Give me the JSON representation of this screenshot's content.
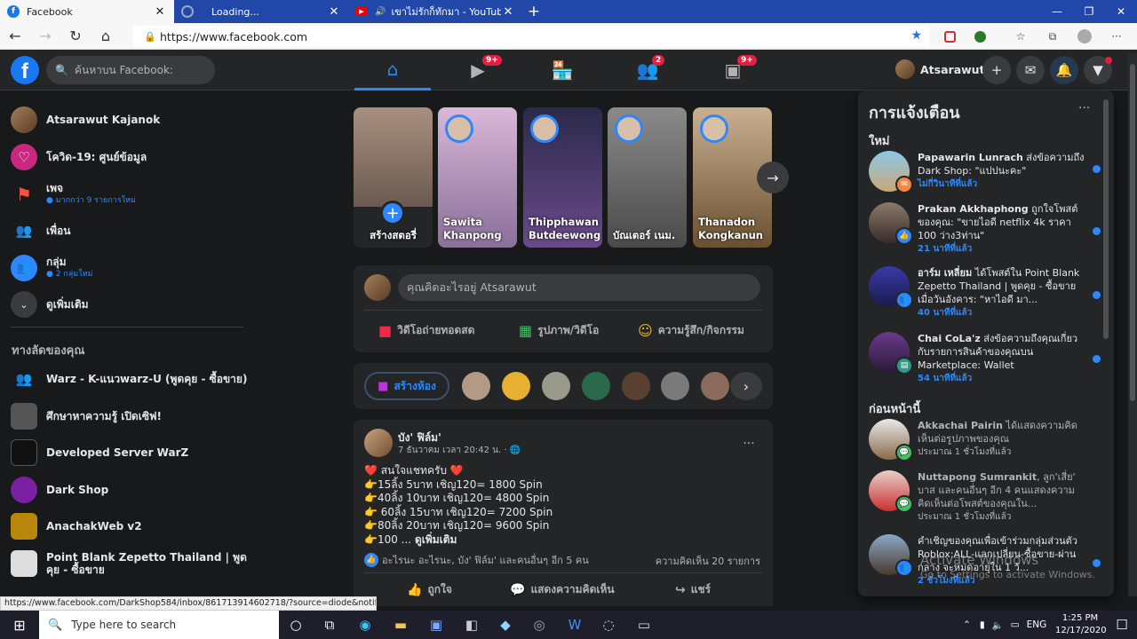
{
  "browser": {
    "tabs": [
      {
        "label": "Facebook",
        "active": true
      },
      {
        "label": "Loading...",
        "active": false
      },
      {
        "label": "เขาไม่รักก็ทักมา - YouTube",
        "active": false
      }
    ],
    "tab_close": "✕",
    "new_tab": "+",
    "url": "https://www.facebook.com",
    "window_controls": {
      "minimize": "—",
      "restore": "❐",
      "close": "✕"
    }
  },
  "header": {
    "search_placeholder": "ค้นหาบน Facebook:",
    "nav_badges": {
      "watch": "9+",
      "groups": "2",
      "gaming": "9+"
    },
    "profile_name": "Atsarawut"
  },
  "sidebar": {
    "items": [
      {
        "label": "Atsarawut Kajanok",
        "sub": ""
      },
      {
        "label": "โควิด-19: ศูนย์ข้อมูล",
        "sub": ""
      },
      {
        "label": "เพจ",
        "sub": "● มากกว่า 9 รายการใหม่"
      },
      {
        "label": "เพื่อน",
        "sub": ""
      },
      {
        "label": "กลุ่ม",
        "sub": "● 2 กลุ่มใหม่"
      },
      {
        "label": "ดูเพิ่มเติม",
        "sub": ""
      }
    ],
    "shortcuts_title": "ทางลัดของคุณ",
    "shortcuts": [
      {
        "label": "Warz - K-แนวwarz-U (พูดคุย - ซื้อขาย)"
      },
      {
        "label": "ศึกษาหาความรู้ เปิดเซิฟ!"
      },
      {
        "label": "Developed Server WarZ"
      },
      {
        "label": "Dark Shop"
      },
      {
        "label": "AnachakWeb v2"
      },
      {
        "label": "Point Blank Zepetto Thailand | พูดคุย - ซื้อขาย"
      }
    ]
  },
  "stories": {
    "create_label": "สร้างสตอรี่",
    "items": [
      {
        "name": "Sawita Khanpong"
      },
      {
        "name": "Thipphawan Butdeewong"
      },
      {
        "name": "บัณเตอร์ เนม."
      },
      {
        "name": "Thanadon Kongkanun"
      }
    ]
  },
  "composer": {
    "placeholder": "คุณคิดอะไรอยู่ Atsarawut",
    "live_label": "วิดีโอถ่ายทอดสด",
    "photo_label": "รูปภาพ/วิดีโอ",
    "feeling_label": "ความรู้สึก/กิจกรรม"
  },
  "rooms": {
    "create_room_label": "สร้างห้อง"
  },
  "post": {
    "author": "บัง' ฟิล์ม'",
    "time": "7 ธันวาคม เวลา 20:42 น. · 🌐",
    "lines": [
      "❤️ สนใจแชทครับ ❤️",
      "👉15ลิ้ง 5บาท เชิญ120= 1800 Spin",
      "👉40ลิ้ง 10บาท เชิญ120= 4800 Spin",
      "👉 60ลิ้ง 15บาท เชิญ120= 7200 Spin",
      "👉80ลิ้ง 20บาท เชิญ120= 9600 Spin",
      "👉100 ..."
    ],
    "see_more": "ดูเพิ่มเติม",
    "reactions_text": "อะไรนะ อะไรนะ, บัง' ฟิล์ม' และคนอื่นๆ อีก 5 คน",
    "comments_count": "ความคิดเห็น 20 รายการ",
    "like_label": "ถูกใจ",
    "comment_label": "แสดงความคิดเห็น",
    "share_label": "แชร์"
  },
  "notifications": {
    "title": "การแจ้งเตือน",
    "more": "···",
    "new_label": "ใหม่",
    "earlier_label": "ก่อนหน้านี้",
    "new_items": [
      {
        "name": "Papawarin Lunrach",
        "text": " ส่งข้อความถึง Dark Shop: \"แปปนะคะ\"",
        "time": "ไม่กี่วินาทีที่แล้ว"
      },
      {
        "name": "Prakan Akkhaphong",
        "text": " ถูกใจโพสต์ของคุณ: \"ขายไอดี netflix 4k ราคา 100 ว่าง3ท่าน\"",
        "time": "21 นาทีที่แล้ว"
      },
      {
        "name": "อาร์ม เหลี่ยม",
        "text": " ได้โพสต์ใน Point Blank Zepetto Thailand | พูดคุย - ซื้อขาย เมื่อวันอังคาร: \"หาไอดี มา...",
        "time": "40 นาทีที่แล้ว"
      },
      {
        "name": "Chai CoLa'z",
        "text": " ส่งข้อความถึงคุณเกี่ยวกับรายการสินค้าของคุณบน Marketplace: Wallet",
        "time": "54 นาทีที่แล้ว"
      }
    ],
    "earlier_items": [
      {
        "name": "Akkachai Pairin",
        "text": " ได้แสดงความคิดเห็นต่อรูปภาพของคุณ",
        "time": "ประมาณ 1 ชั่วโมงที่แล้ว"
      },
      {
        "name": "Nuttapong Sumrankit",
        "text": ", ลูก'เสี่ย' บาส และคนอื่นๆ อีก 4 คนแสดงความคิดเห็นต่อโพสต์ของคุณใน...",
        "time": "ประมาณ 1 ชั่วโมงที่แล้ว"
      },
      {
        "name": "",
        "text": "คำเชิญของคุณเพื่อเข้าร่วมกลุ่มส่วนตัว Roblox:ALL-แลกเปลี่ยน-ซื้อขาย-ผ่านกลาง จะหมดอายุใน 1 วั...",
        "time": "2 ชั่วโมงที่แล้ว"
      }
    ]
  },
  "watermark": {
    "line1": "Activate Windows",
    "line2": "Go to Settings to activate Windows."
  },
  "status_url": "https://www.facebook.com/DarkShop584/inbox/861713914602718/?source=diode&notif_m=ale...",
  "taskbar": {
    "search_placeholder": "Type here to search",
    "lang": "ENG",
    "time": "1:25 PM",
    "date": "12/17/2020"
  }
}
